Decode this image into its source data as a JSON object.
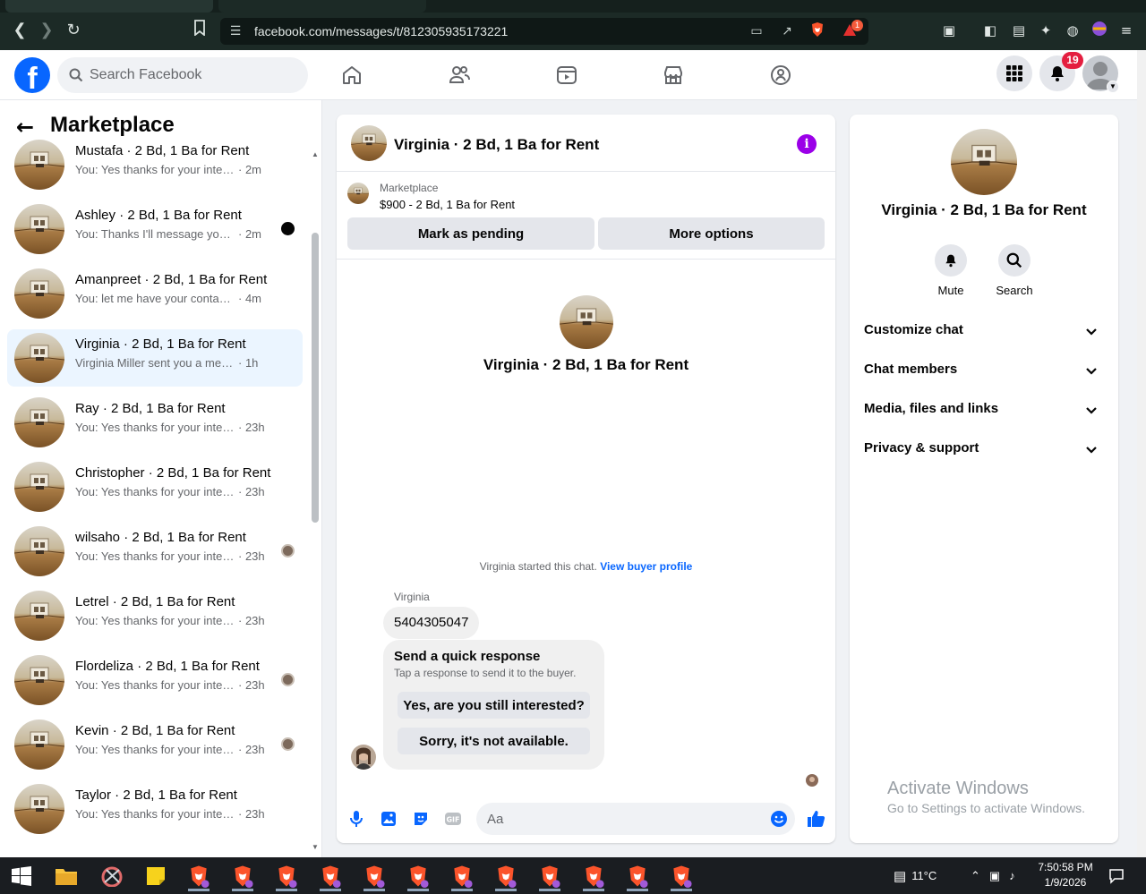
{
  "browser": {
    "url": "facebook.com/messages/t/812305935173221",
    "alert_count": "1"
  },
  "topbar": {
    "search_placeholder": "Search Facebook",
    "notification_count": "19"
  },
  "left_panel": {
    "title": "Marketplace",
    "conversations": [
      {
        "name": "Mustafa · 2 Bd, 1 Ba for Rent",
        "snippet": "You: Yes thanks for your interest fo...",
        "time": "· 2m",
        "active": false,
        "indicator": "none"
      },
      {
        "name": "Ashley · 2 Bd, 1 Ba for Rent",
        "snippet": "You: Thanks I'll message you in ...",
        "time": "· 2m",
        "active": false,
        "indicator": "dark"
      },
      {
        "name": "Amanpreet · 2 Bd, 1 Ba for Rent",
        "snippet": "You: let me have your contact num...",
        "time": "· 4m",
        "active": false,
        "indicator": "none"
      },
      {
        "name": "Virginia · 2 Bd, 1 Ba for Rent",
        "snippet": "Virginia Miller sent you a message ...",
        "time": "· 1h",
        "active": true,
        "indicator": "none"
      },
      {
        "name": "Ray · 2 Bd, 1 Ba for Rent",
        "snippet": "You: Yes thanks for your interest f...",
        "time": "· 23h",
        "active": false,
        "indicator": "none"
      },
      {
        "name": "Christopher · 2 Bd, 1 Ba for Rent",
        "snippet": "You: Yes thanks for your interest f...",
        "time": "· 23h",
        "active": false,
        "indicator": "none"
      },
      {
        "name": "wilsaho · 2 Bd, 1 Ba for Rent",
        "snippet": "You: Yes thanks for your interes...",
        "time": "· 23h",
        "active": false,
        "indicator": "avatar"
      },
      {
        "name": "Letrel · 2 Bd, 1 Ba for Rent",
        "snippet": "You: Yes thanks for your interest f...",
        "time": "· 23h",
        "active": false,
        "indicator": "none"
      },
      {
        "name": "Flordeliza · 2 Bd, 1 Ba for Rent",
        "snippet": "You: Yes thanks for your interes...",
        "time": "· 23h",
        "active": false,
        "indicator": "avatar"
      },
      {
        "name": "Kevin · 2 Bd, 1 Ba for Rent",
        "snippet": "You: Yes thanks for your interes...",
        "time": "· 23h",
        "active": false,
        "indicator": "avatar"
      },
      {
        "name": "Taylor · 2 Bd, 1 Ba for Rent",
        "snippet": "You: Yes thanks for your interest f...",
        "time": "· 23h",
        "active": false,
        "indicator": "none"
      }
    ]
  },
  "chat": {
    "title": "Virginia · 2 Bd, 1 Ba for Rent",
    "listing_source": "Marketplace",
    "listing_title": "$900 - 2 Bd, 1 Ba for Rent",
    "mark_pending_label": "Mark as pending",
    "more_options_label": "More options",
    "hero_title": "Virginia · 2 Bd, 1 Ba for Rent",
    "started_text": "Virginia started this chat.",
    "view_profile_label": "View buyer profile",
    "sender_name": "Virginia",
    "message_text": "5404305047",
    "quick_title": "Send a quick response",
    "quick_subtitle": "Tap a response to send it to the buyer.",
    "quick_reply_1": "Yes, are you still interested?",
    "quick_reply_2": "Sorry, it's not available.",
    "composer_placeholder": "Aa"
  },
  "right_panel": {
    "title": "Virginia · 2 Bd, 1 Ba for Rent",
    "mute_label": "Mute",
    "search_label": "Search",
    "sections": [
      "Customize chat",
      "Chat members",
      "Media, files and links",
      "Privacy & support"
    ]
  },
  "watermark": {
    "line1": "Activate Windows",
    "line2": "Go to Settings to activate Windows."
  },
  "taskbar": {
    "temperature": "11°C",
    "time": "7:50:58 PM",
    "date": "1/9/2026"
  },
  "colors": {
    "brand": "#0866ff",
    "active_row": "#ebf5ff",
    "info_purple": "#9b00e8",
    "badge_red": "#e41e3f"
  }
}
